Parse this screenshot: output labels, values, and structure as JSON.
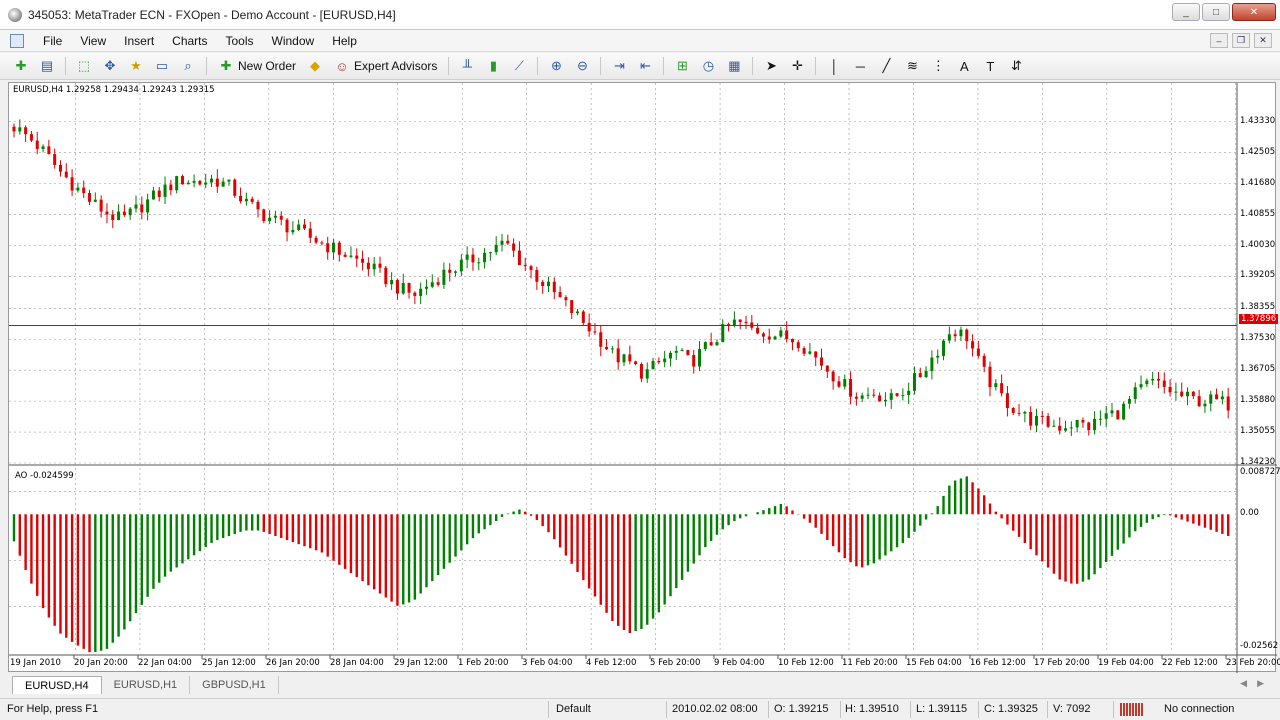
{
  "window": {
    "title": "345053: MetaTrader ECN - FXOpen - Demo Account - [EURUSD,H4]",
    "minimize": "_",
    "maximize": "□",
    "close": "✕"
  },
  "menu": [
    "File",
    "View",
    "Insert",
    "Charts",
    "Tools",
    "Window",
    "Help"
  ],
  "toolbar": {
    "new_order_label": "New Order",
    "expert_advisors_label": "Expert Advisors",
    "icons": [
      "new-chart-icon",
      "profiles-icon",
      "market-watch-icon",
      "navigator-icon",
      "data-window-icon",
      "terminal-icon",
      "tester-icon",
      "new-order-icon",
      "autotrading-icon",
      "expert-advisors-icon",
      "bar-chart-icon",
      "candlesticks-icon",
      "line-chart-icon",
      "zoom-in-icon",
      "zoom-out-icon",
      "chart-shift-icon",
      "autoscroll-icon",
      "indicators-icon",
      "periods-icon",
      "templates-icon",
      "cursor-icon",
      "crosshair-icon",
      "vertical-line-icon",
      "horizontal-line-icon",
      "trendline-icon",
      "fibonacci-icon",
      "grid-icon",
      "text-icon",
      "label-icon",
      "arrows-icon"
    ]
  },
  "chart": {
    "header": "EURUSD,H4  1.29258 1.29434 1.29243 1.29315",
    "current_price_label": "1.37896",
    "price_line_color": "#e00000",
    "bull_color": "#008000",
    "bear_color": "#e00000",
    "price_axis": [
      "1.43330",
      "1.42505",
      "1.41680",
      "1.40855",
      "1.40030",
      "1.39205",
      "1.38355",
      "1.37530",
      "1.36705",
      "1.35880",
      "1.35055",
      "1.34230"
    ],
    "ao_label": "AO -0.024599",
    "ao_axis": [
      "0.008727",
      "0.00",
      "-0.02562"
    ],
    "time_axis": [
      "19 Jan 2010",
      "20 Jan 20:00",
      "22 Jan 04:00",
      "25 Jan 12:00",
      "26 Jan 20:00",
      "28 Jan 04:00",
      "29 Jan 12:00",
      "1 Feb 20:00",
      "3 Feb 04:00",
      "4 Feb 12:00",
      "5 Feb 20:00",
      "9 Feb 04:00",
      "10 Feb 12:00",
      "11 Feb 20:00",
      "15 Feb 04:00",
      "16 Feb 12:00",
      "17 Feb 20:00",
      "19 Feb 04:00",
      "22 Feb 12:00",
      "23 Feb 20:00"
    ]
  },
  "chart_data": {
    "type": "candlestick",
    "symbol": "EURUSD",
    "timeframe": "H4",
    "price_range": [
      1.3423,
      1.4415
    ],
    "close_path": [
      1.432,
      1.429,
      1.425,
      1.42,
      1.416,
      1.412,
      1.409,
      1.407,
      1.41,
      1.413,
      1.416,
      1.418,
      1.417,
      1.418,
      1.416,
      1.412,
      1.409,
      1.407,
      1.405,
      1.403,
      1.401,
      1.399,
      1.397,
      1.395,
      1.392,
      1.389,
      1.387,
      1.39,
      1.393,
      1.395,
      1.397,
      1.399,
      1.401,
      1.396,
      1.392,
      1.388,
      1.384,
      1.38,
      1.376,
      1.371,
      1.369,
      1.366,
      1.369,
      1.372,
      1.369,
      1.373,
      1.377,
      1.38,
      1.378,
      1.377,
      1.376,
      1.375,
      1.371,
      1.367,
      1.363,
      1.36,
      1.361,
      1.359,
      1.362,
      1.366,
      1.372,
      1.378,
      1.376,
      1.367,
      1.361,
      1.357,
      1.354,
      1.353,
      1.352,
      1.353,
      1.352,
      1.355,
      1.356,
      1.361,
      1.364,
      1.362,
      1.36,
      1.359,
      1.359,
      1.358
    ],
    "ao_range": [
      -0.02562,
      0.008727
    ],
    "ao_values": [
      -0.005,
      -0.012,
      -0.018,
      -0.022,
      -0.024,
      -0.0256,
      -0.025,
      -0.022,
      -0.018,
      -0.014,
      -0.011,
      -0.009,
      -0.007,
      -0.005,
      -0.004,
      -0.003,
      -0.003,
      -0.004,
      -0.005,
      -0.006,
      -0.007,
      -0.009,
      -0.011,
      -0.013,
      -0.015,
      -0.017,
      -0.016,
      -0.013,
      -0.01,
      -0.007,
      -0.004,
      -0.002,
      0.0,
      0.001,
      -0.001,
      -0.004,
      -0.008,
      -0.012,
      -0.016,
      -0.02,
      -0.022,
      -0.021,
      -0.018,
      -0.014,
      -0.01,
      -0.006,
      -0.003,
      -0.001,
      0.0,
      0.001,
      0.002,
      0.0,
      -0.002,
      -0.005,
      -0.008,
      -0.01,
      -0.009,
      -0.007,
      -0.005,
      -0.002,
      0.001,
      0.006,
      0.007,
      0.004,
      0.0,
      -0.003,
      -0.006,
      -0.009,
      -0.012,
      -0.013,
      -0.012,
      -0.009,
      -0.006,
      -0.003,
      -0.001,
      0.0,
      -0.001,
      -0.002,
      -0.003,
      -0.004
    ]
  },
  "tabs": [
    "EURUSD,H4",
    "EURUSD,H1",
    "GBPUSD,H1"
  ],
  "status": {
    "help": "For Help, press F1",
    "profile": "Default",
    "time": "2010.02.02 08:00",
    "open": "O: 1.39215",
    "high": "H: 1.39510",
    "low": "L: 1.39115",
    "close": "C: 1.39325",
    "volume": "V: 7092",
    "connection": "No connection"
  }
}
